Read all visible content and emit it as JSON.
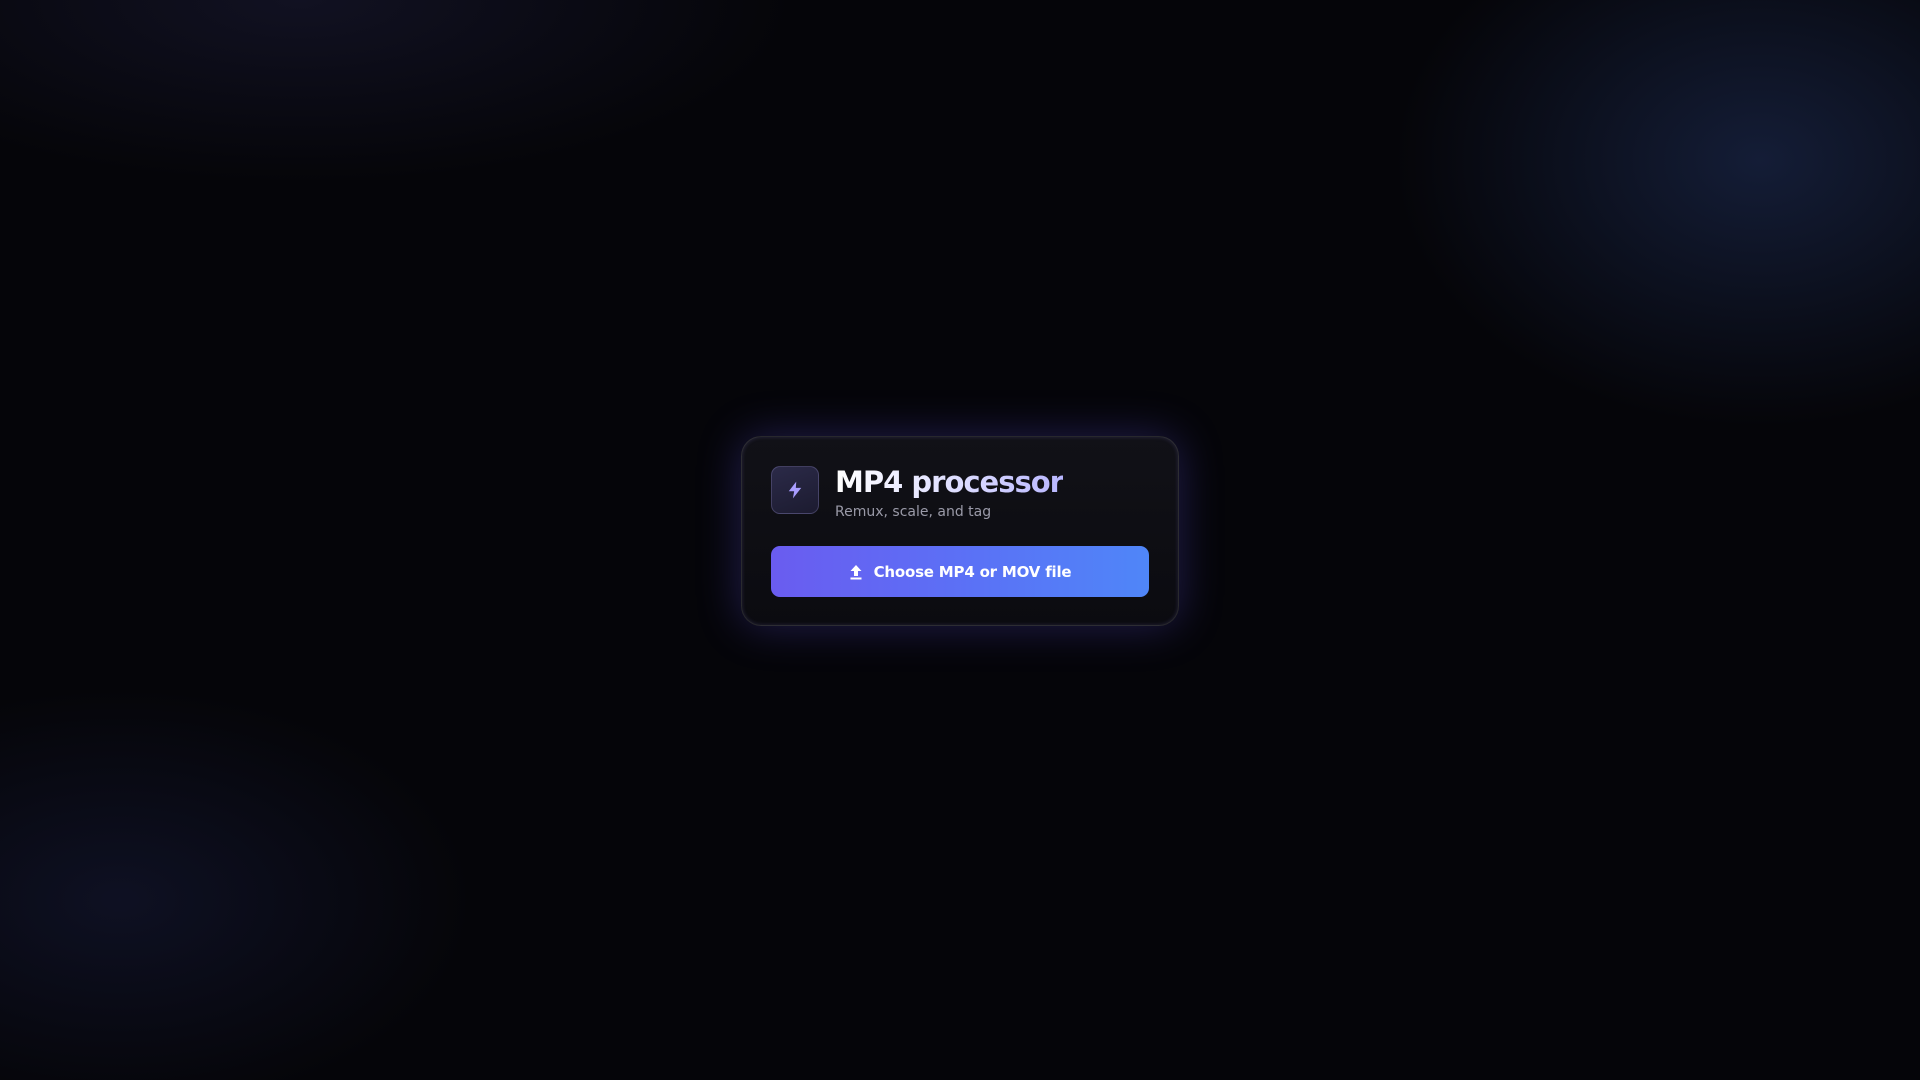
{
  "app": {
    "title": "MP4 processor",
    "subtitle": "Remux, scale, and tag",
    "icon": "lightning-bolt-icon"
  },
  "upload": {
    "label": "Choose MP4 or MOV file",
    "icon": "upload-arrow-icon"
  },
  "colors": {
    "background": "#050509",
    "card": "#0f0f15",
    "accent_start": "#6a5cf0",
    "accent_end": "#4f86f8",
    "icon_accent": "#a99dff"
  }
}
